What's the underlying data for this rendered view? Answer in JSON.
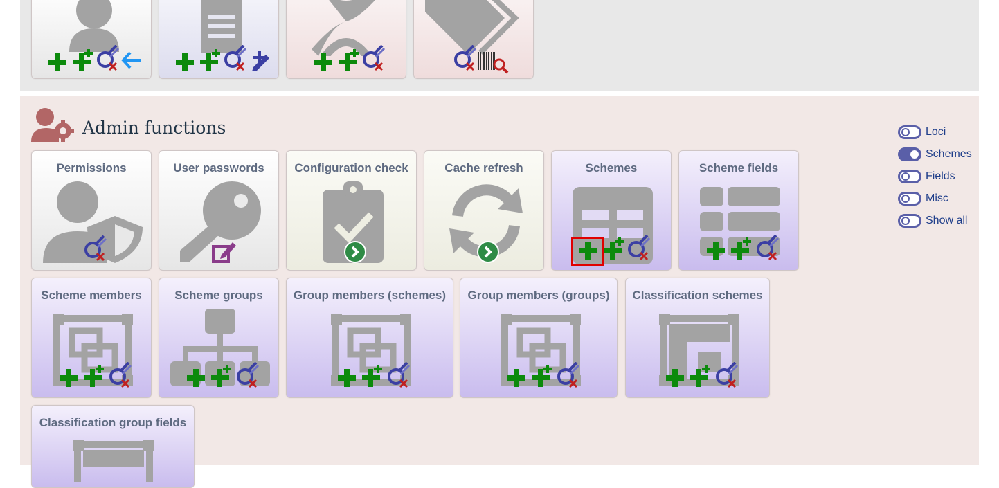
{
  "admin": {
    "title": "Admin functions",
    "tiles_row1": [
      {
        "title": "Permissions"
      },
      {
        "title": "User passwords"
      },
      {
        "title": "Configuration check"
      },
      {
        "title": "Cache refresh"
      },
      {
        "title": "Schemes"
      },
      {
        "title": "Scheme fields"
      }
    ],
    "tiles_row2": [
      {
        "title": "Scheme members"
      },
      {
        "title": "Scheme groups"
      },
      {
        "title": "Group members (schemes)"
      },
      {
        "title": "Group members (groups)"
      },
      {
        "title": "Classification schemes"
      }
    ],
    "tiles_row3": [
      {
        "title": "Classification group fields"
      }
    ]
  },
  "filters": [
    {
      "label": "Loci",
      "on": false
    },
    {
      "label": "Schemes",
      "on": true
    },
    {
      "label": "Fields",
      "on": false
    },
    {
      "label": "Misc",
      "on": false
    },
    {
      "label": "Show all",
      "on": false
    }
  ],
  "colors": {
    "add": "#0c8a0c",
    "query": "#3b3fa3",
    "delete": "#c02020",
    "edit": "#8a3c8a",
    "go": "#2e8b45",
    "icon_grey": "#a3a3a3",
    "highlight": "#e00000",
    "section_title": "#213547",
    "tile_title": "#5e6a80",
    "admin_icon": "#b26666"
  },
  "icons": {
    "add": "plus-icon",
    "batch_add": "double-plus-icon",
    "query": "query-icon",
    "edit": "edit-icon",
    "go": "go-arrow-icon",
    "barcode": "barcode-search-icon",
    "back": "back-arrow-icon"
  }
}
